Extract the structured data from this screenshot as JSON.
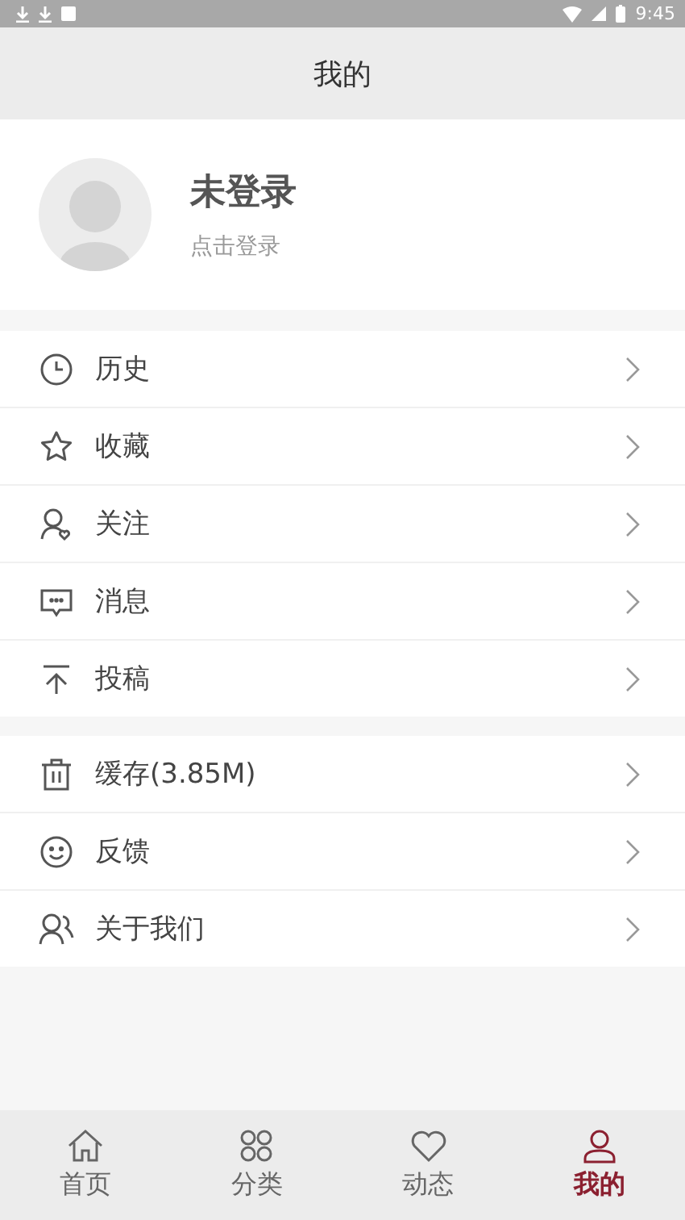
{
  "status_bar": {
    "time": "9:45"
  },
  "header": {
    "title": "我的"
  },
  "profile": {
    "name": "未登录",
    "hint": "点击登录"
  },
  "menu_groups": [
    {
      "items": [
        {
          "kind": "clock",
          "label": "历史"
        },
        {
          "kind": "star",
          "label": "收藏"
        },
        {
          "kind": "follow",
          "label": "关注"
        },
        {
          "kind": "message",
          "label": "消息"
        },
        {
          "kind": "upload",
          "label": "投稿"
        }
      ]
    },
    {
      "items": [
        {
          "kind": "trash",
          "label": "缓存(3.85M)"
        },
        {
          "kind": "smile",
          "label": "反馈"
        },
        {
          "kind": "people",
          "label": "关于我们"
        }
      ]
    }
  ],
  "tab_bar": [
    {
      "kind": "home",
      "label": "首页",
      "selected": false
    },
    {
      "kind": "grid",
      "label": "分类",
      "selected": false
    },
    {
      "kind": "heart",
      "label": "动态",
      "selected": false
    },
    {
      "kind": "person",
      "label": "我的",
      "selected": true
    }
  ]
}
